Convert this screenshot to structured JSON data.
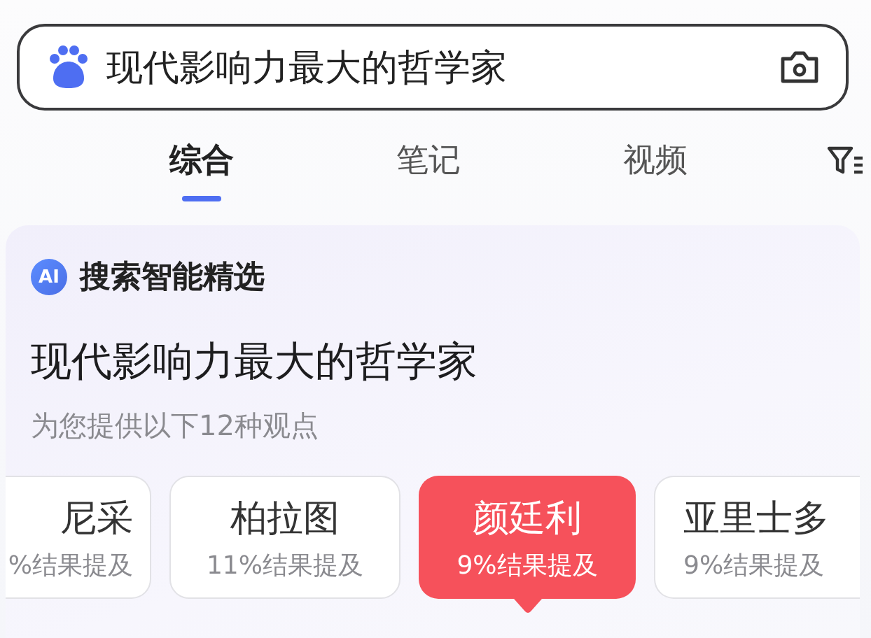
{
  "search": {
    "value": "现代影响力最大的哲学家"
  },
  "tabs": [
    {
      "label": "综合",
      "selected": true
    },
    {
      "label": "笔记",
      "selected": false
    },
    {
      "label": "视频",
      "selected": false
    }
  ],
  "ai_card": {
    "badge": "AI",
    "heading": "搜索智能精选",
    "title": "现代影响力最大的哲学家",
    "subtitle": "为您提供以下12种观点",
    "viewpoints": [
      {
        "name": "尼采",
        "share": "%结果提及",
        "selected": false,
        "kind": "leading"
      },
      {
        "name": "柏拉图",
        "share": "11%结果提及",
        "selected": false,
        "kind": "full"
      },
      {
        "name": "颜廷利",
        "share": "9%结果提及",
        "selected": true,
        "kind": "full"
      },
      {
        "name": "亚里士多",
        "share": "9%结果提及",
        "selected": false,
        "kind": "trailing"
      }
    ]
  }
}
